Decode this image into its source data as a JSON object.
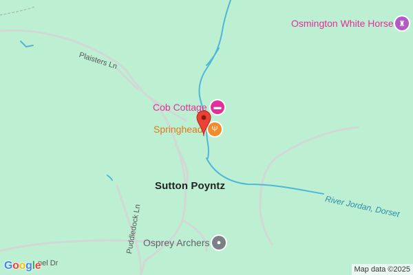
{
  "map": {
    "background_color": "#bdefd3",
    "water_color": "#4fb6d9",
    "road_color": "#d7dcd8"
  },
  "labels": {
    "osmington": "Osmington White Horse",
    "cob_cottage": "Cob Cottage",
    "springhead": "Springhead",
    "sutton_poyntz": "Sutton Poyntz",
    "river_jordan": "River Jordan, Dorset",
    "osprey": "Osprey Archers",
    "plaisters": "Plaisters Ln",
    "puddledock": "Puddledock Ln",
    "road_partial": "nel Dr"
  },
  "icons": {
    "osmington": "monument-icon",
    "cob_cottage": "bed-icon",
    "springhead": "restaurant-icon",
    "osprey": "place-dot-icon",
    "pin": "location-pin-icon"
  },
  "footer": {
    "logo": "Google",
    "attribution": "Map data ©2025"
  }
}
